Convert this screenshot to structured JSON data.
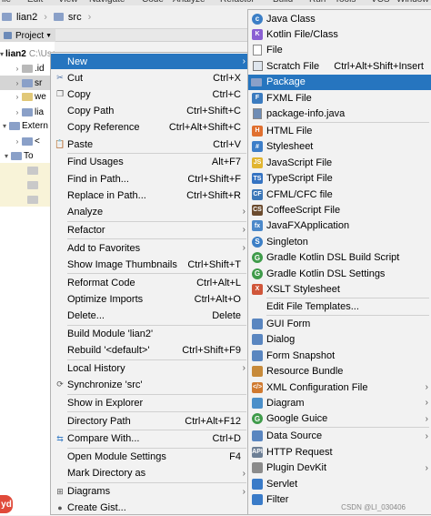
{
  "nav": {
    "project": "lian2",
    "folder": "src",
    "clipped_menu": [
      "ile",
      "Edit",
      "View",
      "Navigate",
      "Code",
      "Analyze",
      "Refactor",
      "Build",
      "Run",
      "Tools",
      "VCS",
      "Window",
      "Help"
    ]
  },
  "project_tab": {
    "label": "Project"
  },
  "tree": [
    {
      "text": "lian2",
      "suffix": "C:\\Users\\Lenovo\\Id",
      "bold": true
    },
    {
      "text": ".id"
    },
    {
      "text": "sr",
      "selected": true
    },
    {
      "text": "we"
    },
    {
      "text": "lia"
    },
    {
      "text": "Extern"
    },
    {
      "text": "<"
    },
    {
      "text": "To"
    }
  ],
  "context_menu": [
    {
      "label": "New",
      "submenu": true,
      "active": true
    },
    {
      "icon": "cut-icon",
      "label": "Cut",
      "shortcut": "Ctrl+X"
    },
    {
      "icon": "copy-icon",
      "label": "Copy",
      "shortcut": "Ctrl+C"
    },
    {
      "label": "Copy Path",
      "shortcut": "Ctrl+Shift+C"
    },
    {
      "label": "Copy Reference",
      "shortcut": "Ctrl+Alt+Shift+C"
    },
    {
      "icon": "paste-icon",
      "label": "Paste",
      "shortcut": "Ctrl+V",
      "sep_after": true
    },
    {
      "label": "Find Usages",
      "shortcut": "Alt+F7"
    },
    {
      "label": "Find in Path...",
      "shortcut": "Ctrl+Shift+F"
    },
    {
      "label": "Replace in Path...",
      "shortcut": "Ctrl+Shift+R"
    },
    {
      "label": "Analyze",
      "submenu": true,
      "sep_after": true
    },
    {
      "label": "Refactor",
      "submenu": true,
      "sep_after": true
    },
    {
      "label": "Add to Favorites",
      "submenu": true
    },
    {
      "label": "Show Image Thumbnails",
      "shortcut": "Ctrl+Shift+T",
      "sep_after": true
    },
    {
      "label": "Reformat Code",
      "shortcut": "Ctrl+Alt+L"
    },
    {
      "label": "Optimize Imports",
      "shortcut": "Ctrl+Alt+O"
    },
    {
      "label": "Delete...",
      "shortcut": "Delete",
      "sep_after": true
    },
    {
      "label": "Build Module 'lian2'"
    },
    {
      "label": "Rebuild '<default>'",
      "shortcut": "Ctrl+Shift+F9",
      "sep_after": true
    },
    {
      "label": "Local History",
      "submenu": true
    },
    {
      "icon": "sync-icon",
      "label": "Synchronize 'src'",
      "sep_after": true
    },
    {
      "label": "Show in Explorer",
      "sep_after": true
    },
    {
      "label": "Directory Path",
      "shortcut": "Ctrl+Alt+F12",
      "sep_after": true
    },
    {
      "icon": "compare-icon",
      "label": "Compare With...",
      "shortcut": "Ctrl+D",
      "sep_after": true
    },
    {
      "label": "Open Module Settings",
      "shortcut": "F4"
    },
    {
      "label": "Mark Directory as",
      "submenu": true,
      "sep_after": true
    },
    {
      "icon": "diagram-icon",
      "label": "Diagrams",
      "submenu": true
    },
    {
      "icon": "github-icon",
      "label": "Create Gist..."
    }
  ],
  "submenu_new": [
    {
      "icon": "c",
      "color": "#3c7fc6",
      "shape": "circ",
      "label": "Java Class"
    },
    {
      "icon": "K",
      "color": "#8a5fd3",
      "shape": "sq",
      "label": "Kotlin File/Class"
    },
    {
      "icon": "",
      "color": "#ffffff",
      "shape": "file",
      "label": "File"
    },
    {
      "icon": "",
      "color": "#9aa4b0",
      "shape": "scratch",
      "label": "Scratch File",
      "shortcut": "Ctrl+Alt+Shift+Insert"
    },
    {
      "icon": "",
      "color": "#8aa0c8",
      "shape": "folder",
      "label": "Package",
      "active": true
    },
    {
      "icon": "F",
      "color": "#3b7bbf",
      "shape": "sq",
      "label": "FXML File"
    },
    {
      "icon": "",
      "color": "#6e8cb5",
      "shape": "file",
      "label": "package-info.java",
      "sep_after": true
    },
    {
      "icon": "H",
      "color": "#e07030",
      "shape": "sq",
      "label": "HTML File"
    },
    {
      "icon": "#",
      "color": "#3d7ec8",
      "shape": "sq",
      "label": "Stylesheet"
    },
    {
      "icon": "JS",
      "color": "#e1b530",
      "shape": "sq",
      "label": "JavaScript File"
    },
    {
      "icon": "TS",
      "color": "#3573c2",
      "shape": "sq",
      "label": "TypeScript File"
    },
    {
      "icon": "CF",
      "color": "#3c77b8",
      "shape": "sq",
      "label": "CFML/CFC file"
    },
    {
      "icon": "CS",
      "color": "#6b4b2e",
      "shape": "sq",
      "label": "CoffeeScript File"
    },
    {
      "icon": "fx",
      "color": "#4b88c9",
      "shape": "sq",
      "label": "JavaFXApplication"
    },
    {
      "icon": "S",
      "color": "#3c7fc6",
      "shape": "circ",
      "label": "Singleton"
    },
    {
      "icon": "G",
      "color": "#3f9b4a",
      "shape": "circ",
      "label": "Gradle Kotlin DSL Build Script"
    },
    {
      "icon": "G",
      "color": "#3f9b4a",
      "shape": "circ",
      "label": "Gradle Kotlin DSL Settings"
    },
    {
      "icon": "X",
      "color": "#d0563a",
      "shape": "sq",
      "label": "XSLT Stylesheet",
      "sep_after": true
    },
    {
      "icon": "",
      "color": "",
      "shape": "none",
      "label": "Edit File Templates...",
      "sep_after": true
    },
    {
      "icon": "",
      "color": "#5a86c0",
      "shape": "sq",
      "label": "GUI Form"
    },
    {
      "icon": "",
      "color": "#5a86c0",
      "shape": "sq",
      "label": "Dialog"
    },
    {
      "icon": "",
      "color": "#5a86c0",
      "shape": "sq",
      "label": "Form Snapshot"
    },
    {
      "icon": "",
      "color": "#c78a3a",
      "shape": "sq",
      "label": "Resource Bundle"
    },
    {
      "icon": "</>",
      "color": "#d07a30",
      "shape": "sq",
      "label": "XML Configuration File",
      "submenu": true
    },
    {
      "icon": "",
      "color": "#4b8fc9",
      "shape": "sq",
      "label": "Diagram",
      "submenu": true
    },
    {
      "icon": "G",
      "color": "#3f9b4a",
      "shape": "circ",
      "label": "Google Guice",
      "submenu": true,
      "sep_after": true
    },
    {
      "icon": "",
      "color": "#5a86c0",
      "shape": "sq",
      "label": "Data Source",
      "submenu": true
    },
    {
      "icon": "API",
      "color": "#6d7f95",
      "shape": "sq",
      "label": "HTTP Request"
    },
    {
      "icon": "",
      "color": "#8b8b8b",
      "shape": "sq",
      "label": "Plugin DevKit",
      "submenu": true
    },
    {
      "icon": "",
      "color": "#3a7bc8",
      "shape": "sq",
      "label": "Servlet"
    },
    {
      "icon": "",
      "color": "#3a7bc8",
      "shape": "sq",
      "label": "Filter"
    }
  ],
  "watermark": "CSDN @LI_030406",
  "badge_text": "yd",
  "colors": {
    "accent": "#2675bf",
    "menu_bg": "#f2f2f2",
    "badge": "#e04a3a"
  }
}
